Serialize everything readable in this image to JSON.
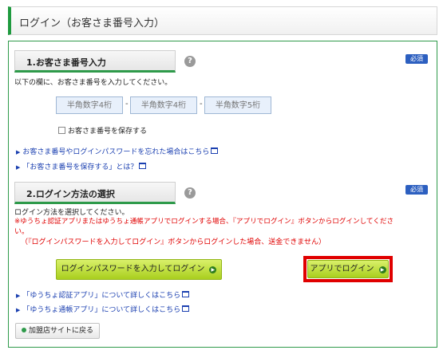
{
  "header": {
    "title": "ログイン（お客さま番号入力）"
  },
  "section1": {
    "title": "1.お客さま番号入力",
    "help": "?",
    "badge": "必須",
    "instruction": "以下の欄に、お客さま番号を入力してください。",
    "fields": [
      {
        "placeholder": "半角数字4桁",
        "value": ""
      },
      {
        "placeholder": "半角数字4桁",
        "value": ""
      },
      {
        "placeholder": "半角数字5桁",
        "value": ""
      }
    ],
    "separator": "-",
    "checkbox": {
      "label": "お客さま番号を保存する",
      "checked": false
    },
    "links": [
      "お客さま番号やログインパスワードを忘れた場合はこちら",
      "「お客さま番号を保存する」とは？"
    ]
  },
  "section2": {
    "title": "2.ログイン方法の選択",
    "help": "?",
    "badge": "必須",
    "instruction": "ログイン方法を選択してください。",
    "notice_line1": "※ゆうちょ認証アプリまたはゆうちょ通帳アプリでログインする場合、『アプリでログイン』ボタンからログインしてくださ",
    "notice_line2": "い。",
    "notice_line3": "（『ログインパスワードを入力してログイン』ボタンからログインした場合、送金できません）",
    "button_password": "ログインパスワードを入力してログイン",
    "button_app": "アプリでログイン",
    "links": [
      "「ゆうちょ認証アプリ」について詳しくはこちら",
      "「ゆうちょ通帳アプリ」について詳しくはこちら"
    ]
  },
  "back_button": "加盟店サイトに戻る",
  "colors": {
    "accent": "#2e9a4a",
    "button": "#b8dc2a",
    "highlight": "#e00000",
    "link": "#1a3fb0",
    "badge": "#2c5fc0"
  },
  "icons": {
    "help": "question-circle-icon",
    "link": "external-window-icon",
    "arrow": "arrow-right-icon"
  }
}
